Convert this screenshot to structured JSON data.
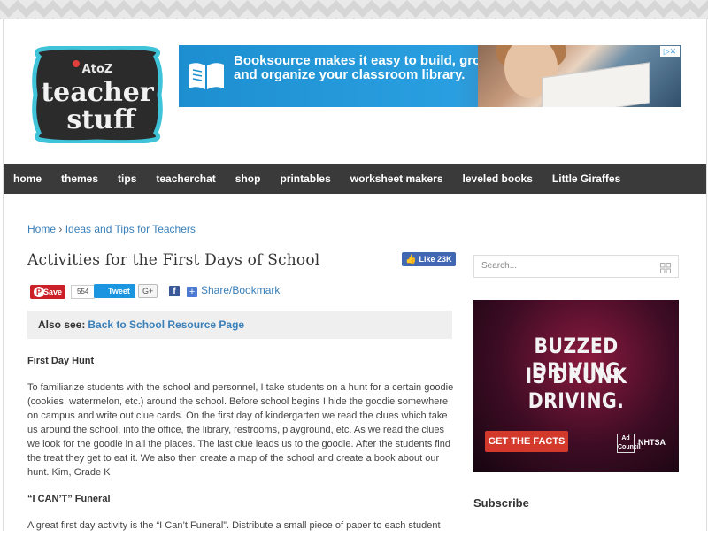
{
  "logo": {
    "line1": "AtoZ",
    "line2": "teacher",
    "line3": "stuff"
  },
  "banner": {
    "text": "Booksource makes it easy to build, grow and organize your classroom library.",
    "adchoice": "▷✕"
  },
  "nav": [
    "home",
    "themes",
    "tips",
    "teacherchat",
    "shop",
    "printables",
    "worksheet makers",
    "leveled books",
    "Little Giraffes"
  ],
  "breadcrumb": {
    "home": "Home",
    "sep": " › ",
    "section": "Ideas and Tips for Teachers"
  },
  "title": "Activities for the First Days of School",
  "fb_like": {
    "label": "Like",
    "count": "23K"
  },
  "share": {
    "save": "Save",
    "save_count": "554",
    "tweet": "Tweet",
    "gplus": "G+",
    "bookmark": "Share/Bookmark"
  },
  "also_see": {
    "label": "Also see:",
    "link": "Back to School Resource Page"
  },
  "article": {
    "h1": "First Day Hunt",
    "p1": "To familiarize students with the school and personnel, I take students on a hunt for a certain goodie (cookies, watermelon, etc.) around the school. Before school begins I hide the goodie somewhere on campus and write out clue cards. On the first day of kindergarten we read the clues which take us around the school, into the office, the library, restrooms, playground, etc. As we read the clues we look for the goodie in all the places. The last clue leads us to the goodie. After the students find the treat they get to eat it. We also then create a map of the school and create a book about our hunt.  Kim, Grade K",
    "h2": "“I CAN’T” Funeral",
    "p2": "A great first day activity is the “I Can’t Funeral”. Distribute a small piece of paper to each student"
  },
  "sidebar": {
    "search_placeholder": "Search...",
    "ad_line1": "BUZZED DRIVING",
    "ad_line2": "IS DRUNK DRIVING.",
    "ad_cta": "GET THE FACTS",
    "ad_council": "Ad Council",
    "ad_nhtsa": "NHTSA",
    "subscribe": "Subscribe"
  },
  "colors": {
    "nav_bg": "#3a3a3a",
    "link": "#3a7fb8",
    "banner_blue": "#1d8fd0",
    "logo_border": "#3fc3d9"
  }
}
